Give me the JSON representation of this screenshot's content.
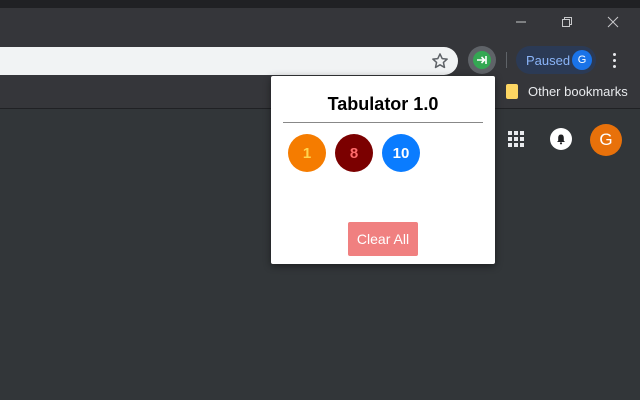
{
  "window_controls": [
    "minimize",
    "restore",
    "close"
  ],
  "toolbar": {
    "star_icon": "star-icon",
    "extension_icon": "tabulator-extension-icon",
    "profile_status": "Paused",
    "profile_initial": "G"
  },
  "bookmarks": {
    "other_label": "Other bookmarks"
  },
  "page": {
    "avatar_initial": "G"
  },
  "popup": {
    "title": "Tabulator 1.0",
    "counters": [
      {
        "value": "1",
        "bg": "#f57c00",
        "fg": "#ffd54f"
      },
      {
        "value": "8",
        "bg": "#7b0000",
        "fg": "#ff6b6b"
      },
      {
        "value": "10",
        "bg": "#0a7cff",
        "fg": "#ffffff"
      }
    ],
    "clear_button": "Clear All"
  },
  "colors": {
    "background": "#323639",
    "toolbar": "#35363a",
    "popup_button": "#f08080",
    "avatar": "#e8710a"
  }
}
